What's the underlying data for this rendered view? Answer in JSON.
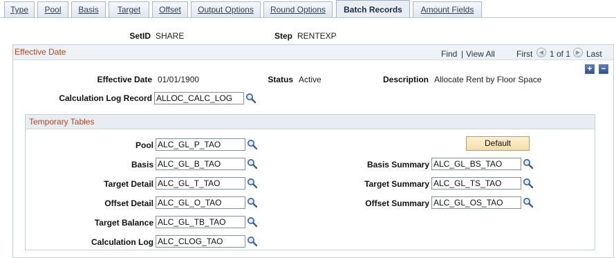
{
  "tabs": [
    {
      "label": "Type"
    },
    {
      "label": "Pool"
    },
    {
      "label": "Basis"
    },
    {
      "label": "Target"
    },
    {
      "label": "Offset"
    },
    {
      "label": "Output Options"
    },
    {
      "label": "Round Options"
    },
    {
      "label": "Batch Records",
      "active": true
    },
    {
      "label": "Amount Fields"
    }
  ],
  "header": {
    "setid_label": "SetID",
    "setid_value": "SHARE",
    "step_label": "Step",
    "step_value": "RENTEXP"
  },
  "effective": {
    "title": "Effective Date",
    "find": "Find",
    "view_all": "View All",
    "first": "First",
    "range": "1 of 1",
    "last": "Last",
    "eff_date_label": "Effective Date",
    "eff_date_value": "01/01/1900",
    "status_label": "Status",
    "status_value": "Active",
    "desc_label": "Description",
    "desc_value": "Allocate Rent by Floor Space",
    "calc_log_record_label": "Calculation Log Record",
    "calc_log_record_value": "ALLOC_CALC_LOG"
  },
  "temp": {
    "title": "Temporary Tables",
    "default_button": "Default",
    "pool_label": "Pool",
    "pool_value": "ALC_GL_P_TAO",
    "basis_label": "Basis",
    "basis_value": "ALC_GL_B_TAO",
    "target_detail_label": "Target Detail",
    "target_detail_value": "ALC_GL_T_TAO",
    "offset_detail_label": "Offset Detail",
    "offset_detail_value": "ALC_GL_O_TAO",
    "target_balance_label": "Target Balance",
    "target_balance_value": "ALC_GL_TB_TAO",
    "calc_log_label": "Calculation Log",
    "calc_log_value": "ALC_CLOG_TAO",
    "basis_summary_label": "Basis Summary",
    "basis_summary_value": "ALC_GL_BS_TAO",
    "target_summary_label": "Target Summary",
    "target_summary_value": "ALC_GL_TS_TAO",
    "offset_summary_label": "Offset Summary",
    "offset_summary_value": "ALC_GL_OS_TAO"
  }
}
